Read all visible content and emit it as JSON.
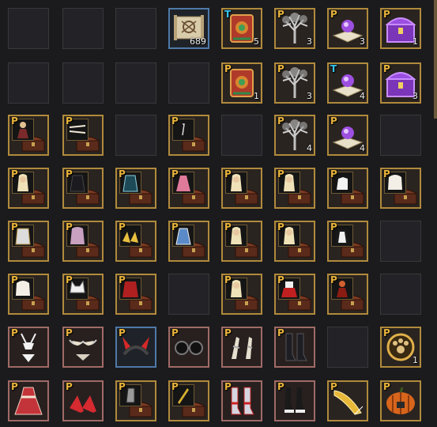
{
  "inventory": {
    "rows": [
      [
        {
          "state": "empty"
        },
        {
          "state": "empty"
        },
        {
          "state": "empty"
        },
        {
          "state": "item",
          "frame": "blue",
          "letter": "",
          "count": "689",
          "icon": "treasure-map-icon"
        },
        {
          "state": "item",
          "frame": "gold",
          "letter": "T",
          "count": "5",
          "icon": "crimson-tome-icon"
        },
        {
          "state": "item",
          "frame": "gold",
          "letter": "P",
          "count": "3",
          "icon": "silver-tree-icon"
        },
        {
          "state": "item",
          "frame": "gold",
          "letter": "P",
          "count": "3",
          "icon": "orb-book-icon"
        },
        {
          "state": "item",
          "frame": "gold",
          "letter": "P",
          "count": "1",
          "icon": "purple-chest-icon"
        }
      ],
      [
        {
          "state": "empty"
        },
        {
          "state": "empty"
        },
        {
          "state": "empty"
        },
        {
          "state": "empty"
        },
        {
          "state": "item",
          "frame": "gold",
          "letter": "P",
          "count": "1",
          "icon": "crimson-tome-icon"
        },
        {
          "state": "item",
          "frame": "gold",
          "letter": "P",
          "count": "3",
          "icon": "silver-tree-icon"
        },
        {
          "state": "item",
          "frame": "gold",
          "letter": "T",
          "count": "4",
          "icon": "orb-book-icon"
        },
        {
          "state": "item",
          "frame": "gold",
          "letter": "P",
          "count": "3",
          "icon": "purple-chest-icon"
        }
      ],
      [
        {
          "state": "item",
          "frame": "gold",
          "letter": "P",
          "count": "",
          "icon": "outfit-chest-icon",
          "preview": "figure-dark-red"
        },
        {
          "state": "item",
          "frame": "gold",
          "letter": "P",
          "count": "",
          "icon": "outfit-chest-icon",
          "preview": "hairpin"
        },
        {
          "state": "empty"
        },
        {
          "state": "item",
          "frame": "gold",
          "letter": "P",
          "count": "",
          "icon": "outfit-chest-icon",
          "preview": "dark-note"
        },
        {
          "state": "empty"
        },
        {
          "state": "item",
          "frame": "gold",
          "letter": "P",
          "count": "4",
          "icon": "silver-tree-icon"
        },
        {
          "state": "item",
          "frame": "gold",
          "letter": "P",
          "count": "4",
          "icon": "orb-book-icon"
        },
        {
          "state": "empty"
        }
      ],
      [
        {
          "state": "item",
          "frame": "gold",
          "letter": "P",
          "count": "",
          "icon": "outfit-chest-icon",
          "preview": "blonde-hair"
        },
        {
          "state": "item",
          "frame": "gold",
          "letter": "P",
          "count": "",
          "icon": "outfit-chest-icon",
          "preview": "black-coat"
        },
        {
          "state": "item",
          "frame": "gold",
          "letter": "P",
          "count": "",
          "icon": "outfit-chest-icon",
          "preview": "teal-armor"
        },
        {
          "state": "item",
          "frame": "gold",
          "letter": "P",
          "count": "",
          "icon": "outfit-chest-icon",
          "preview": "pink-dress"
        },
        {
          "state": "item",
          "frame": "gold",
          "letter": "P",
          "count": "",
          "icon": "outfit-chest-icon",
          "preview": "blonde-hair"
        },
        {
          "state": "item",
          "frame": "gold",
          "letter": "P",
          "count": "",
          "icon": "outfit-chest-icon",
          "preview": "blonde-hair"
        },
        {
          "state": "item",
          "frame": "gold",
          "letter": "P",
          "count": "",
          "icon": "outfit-chest-icon",
          "preview": "white-gloves"
        },
        {
          "state": "item",
          "frame": "gold",
          "letter": "P",
          "count": "",
          "icon": "outfit-chest-icon",
          "preview": "white-hair"
        }
      ],
      [
        {
          "state": "item",
          "frame": "gold",
          "letter": "P",
          "count": "",
          "icon": "outfit-chest-icon",
          "preview": "white-armor"
        },
        {
          "state": "item",
          "frame": "gold",
          "letter": "P",
          "count": "",
          "icon": "outfit-chest-icon",
          "preview": "long-hair"
        },
        {
          "state": "item",
          "frame": "gold",
          "letter": "P",
          "count": "",
          "icon": "outfit-chest-icon",
          "preview": "gold-shoes"
        },
        {
          "state": "item",
          "frame": "gold",
          "letter": "P",
          "count": "",
          "icon": "outfit-chest-icon",
          "preview": "blue-robe"
        },
        {
          "state": "item",
          "frame": "gold",
          "letter": "P",
          "count": "",
          "icon": "outfit-chest-icon",
          "preview": "blonde-hair"
        },
        {
          "state": "item",
          "frame": "gold",
          "letter": "P",
          "count": "",
          "icon": "outfit-chest-icon",
          "preview": "blonde-hair"
        },
        {
          "state": "item",
          "frame": "gold",
          "letter": "P",
          "count": "",
          "icon": "outfit-chest-icon",
          "preview": "maid-outfit"
        },
        {
          "state": "empty"
        }
      ],
      [
        {
          "state": "item",
          "frame": "gold",
          "letter": "P",
          "count": "",
          "icon": "outfit-chest-icon",
          "preview": "white-hair"
        },
        {
          "state": "item",
          "frame": "gold",
          "letter": "P",
          "count": "",
          "icon": "outfit-chest-icon",
          "preview": "cat-hat"
        },
        {
          "state": "item",
          "frame": "gold",
          "letter": "P",
          "count": "",
          "icon": "outfit-chest-icon",
          "preview": "red-outfit"
        },
        {
          "state": "empty"
        },
        {
          "state": "item",
          "frame": "gold",
          "letter": "P",
          "count": "",
          "icon": "outfit-chest-icon",
          "preview": "blonde-hair"
        },
        {
          "state": "item",
          "frame": "gold",
          "letter": "P",
          "count": "",
          "icon": "outfit-chest-icon",
          "preview": "red-skirt"
        },
        {
          "state": "item",
          "frame": "gold",
          "letter": "P",
          "count": "",
          "icon": "outfit-chest-icon",
          "preview": "red-costume"
        },
        {
          "state": "empty"
        }
      ],
      [
        {
          "state": "item",
          "frame": "pink",
          "letter": "P",
          "count": "",
          "icon": "swimsuit-icon"
        },
        {
          "state": "item",
          "frame": "pink",
          "letter": "P",
          "count": "",
          "icon": "bikini-top-icon"
        },
        {
          "state": "item",
          "frame": "blue",
          "letter": "P",
          "count": "",
          "icon": "devil-horns-icon"
        },
        {
          "state": "item",
          "frame": "pink",
          "letter": "P",
          "count": "",
          "icon": "round-glasses-icon"
        },
        {
          "state": "item",
          "frame": "pink",
          "letter": "P",
          "count": "",
          "icon": "sandals-icon"
        },
        {
          "state": "item",
          "frame": "pink",
          "letter": "P",
          "count": "",
          "icon": "black-boots-icon"
        },
        {
          "state": "empty"
        },
        {
          "state": "item",
          "frame": "gold",
          "letter": "P",
          "count": "1",
          "icon": "paw-ring-icon"
        }
      ],
      [
        {
          "state": "item",
          "frame": "pink",
          "letter": "P",
          "count": "",
          "icon": "red-dress-icon"
        },
        {
          "state": "item",
          "frame": "pink",
          "letter": "P",
          "count": "",
          "icon": "red-heels-icon"
        },
        {
          "state": "item",
          "frame": "gold",
          "letter": "P",
          "count": "",
          "icon": "outfit-chest-icon",
          "preview": "gauntlet"
        },
        {
          "state": "item",
          "frame": "gold",
          "letter": "P",
          "count": "",
          "icon": "outfit-chest-icon",
          "preview": "gold-dagger"
        },
        {
          "state": "item",
          "frame": "pink",
          "letter": "P",
          "count": "",
          "icon": "red-boots-icon"
        },
        {
          "state": "item",
          "frame": "pink",
          "letter": "P",
          "count": "",
          "icon": "white-heels-icon"
        },
        {
          "state": "item",
          "frame": "gold",
          "letter": "P",
          "count": "",
          "icon": "golden-horn-icon"
        },
        {
          "state": "item",
          "frame": "gold",
          "letter": "P",
          "count": "",
          "icon": "pumpkin-chest-icon"
        }
      ]
    ]
  },
  "colors": {
    "background": "#1b1b1d",
    "gold_frame": "#b08a3c",
    "blue_frame": "#4f79a8",
    "pink_frame": "#a06a66",
    "letter_p": "#e8b33a",
    "letter_t": "#35c4ee"
  }
}
